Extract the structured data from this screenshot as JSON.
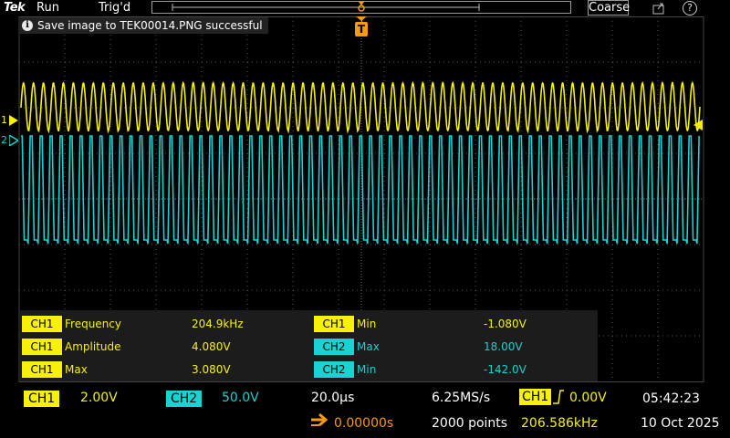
{
  "topbar": {
    "logo": "Tek",
    "run_state": "Run",
    "trigger_state": "Trig'd",
    "mode_button": "Coarse",
    "help": "?"
  },
  "notification": {
    "text": "Save image to TEK00014.PNG successful"
  },
  "trigger_marker": "T",
  "channel_markers": {
    "ch1": "1",
    "ch2": "2"
  },
  "measurements": [
    {
      "channel": "CH1",
      "name": "Frequency",
      "value": "204.9kHz",
      "color": "#f7f10a"
    },
    {
      "channel": "CH1",
      "name": "Amplitude",
      "value": "4.080V",
      "color": "#f7f10a"
    },
    {
      "channel": "CH1",
      "name": "Max",
      "value": "3.080V",
      "color": "#f7f10a"
    },
    {
      "channel": "CH1",
      "name": "Min",
      "value": "-1.080V",
      "color": "#f7f10a"
    },
    {
      "channel": "CH2",
      "name": "Max",
      "value": "18.00V",
      "color": "#19d2d2"
    },
    {
      "channel": "CH2",
      "name": "Min",
      "value": "-142.0V",
      "color": "#19d2d2"
    }
  ],
  "status": {
    "ch1_label": "CH1",
    "ch1_scale": "2.00V",
    "ch2_label": "CH2",
    "ch2_scale": "50.0V",
    "timebase": "20.0µs",
    "sample_rate": "6.25MS/s",
    "trigger_channel": "CH1",
    "trigger_level": "0.00V",
    "time": "05:42:23",
    "horizontal_position": "0.00000s",
    "record_length": "2000 points",
    "trigger_frequency": "206.586kHz",
    "date": "10 Oct 2025"
  },
  "colors": {
    "ch1": "#f7f10a",
    "ch2": "#19d2d2",
    "trigger": "#f59a12",
    "grid": "#555555"
  }
}
